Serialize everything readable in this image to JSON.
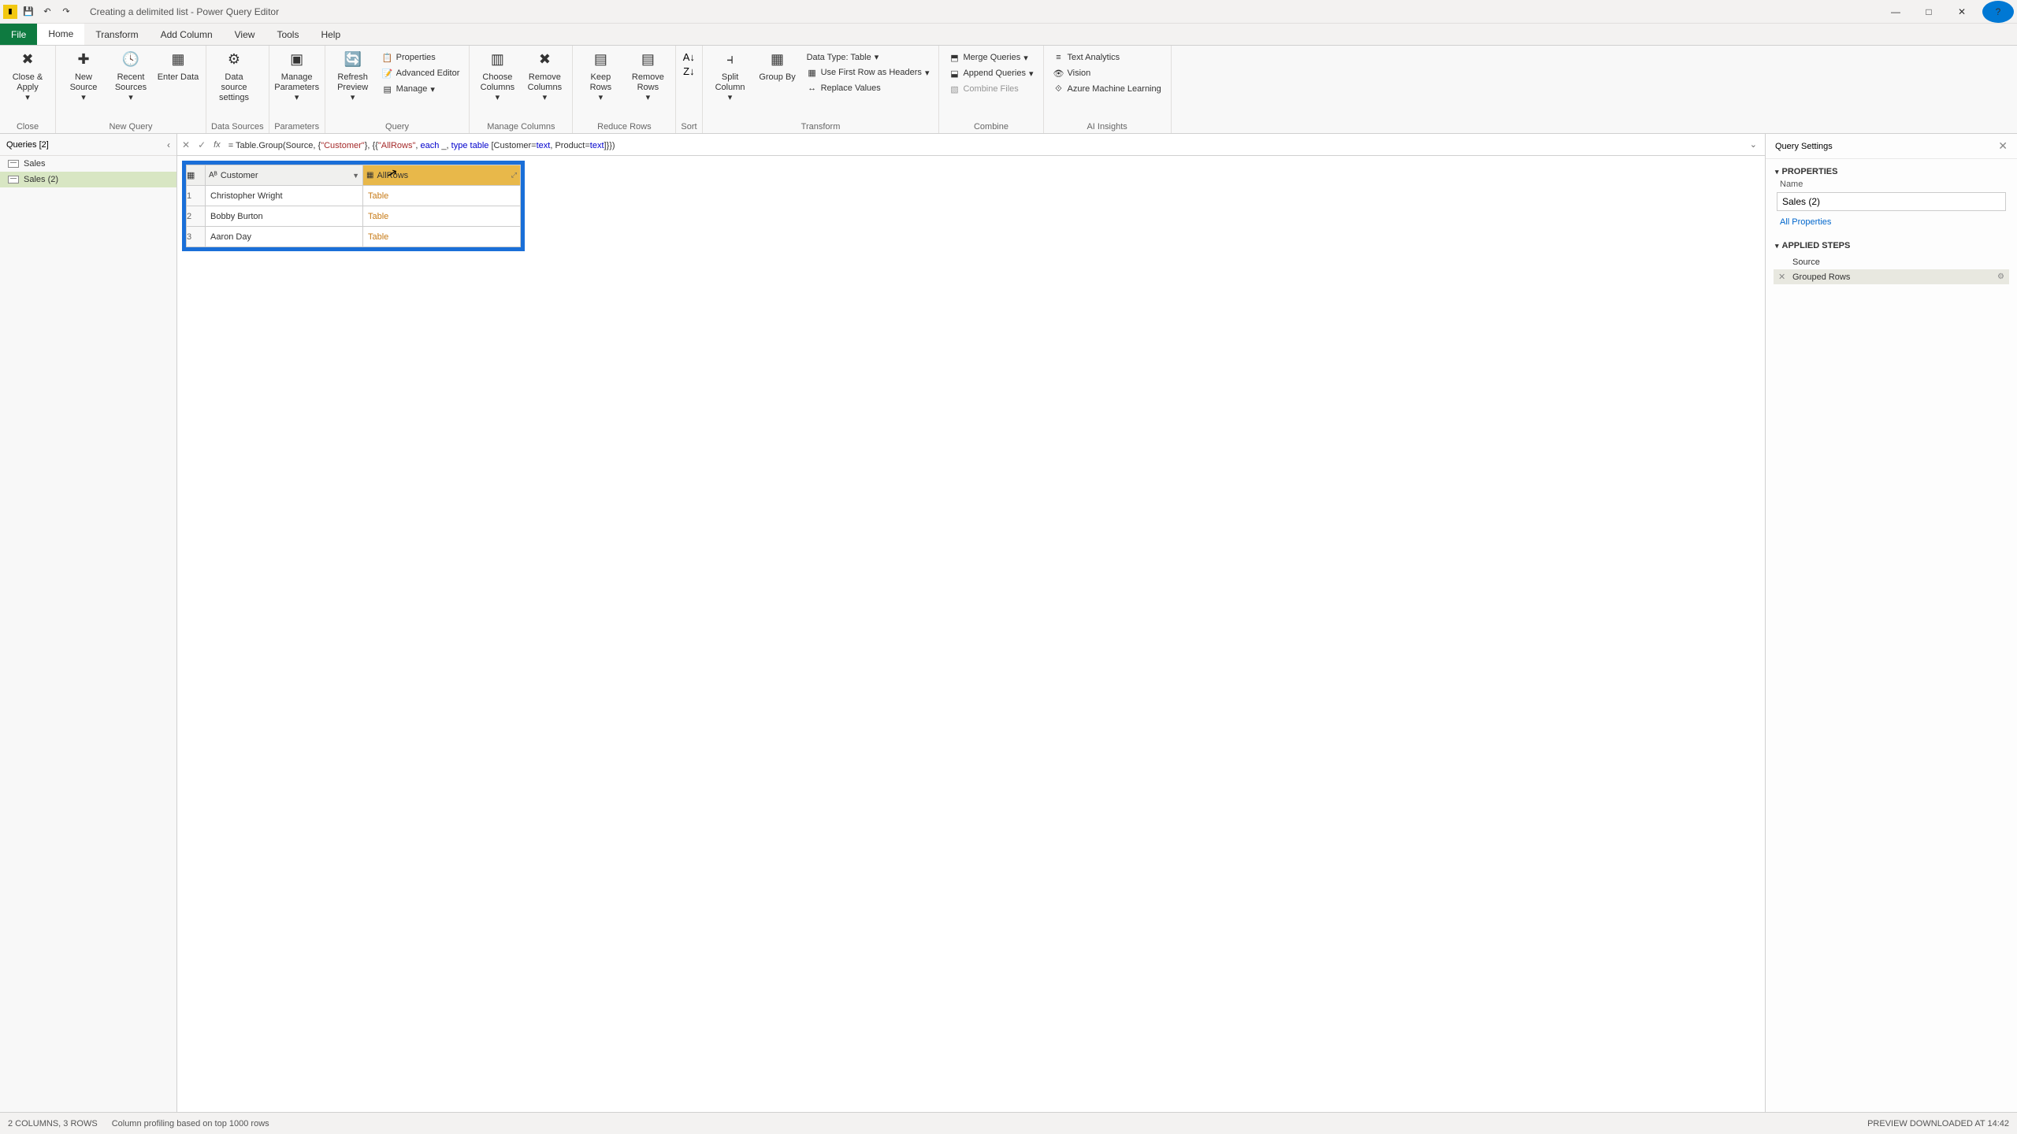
{
  "window": {
    "title": "Creating a delimited list - Power Query Editor"
  },
  "menu": {
    "file": "File",
    "tabs": [
      "Home",
      "Transform",
      "Add Column",
      "View",
      "Tools",
      "Help"
    ]
  },
  "ribbon": {
    "close_apply": "Close & Apply",
    "group_close": "Close",
    "new_source": "New Source",
    "recent_sources": "Recent Sources",
    "enter_data": "Enter Data",
    "group_newquery": "New Query",
    "data_source_settings": "Data source settings",
    "group_datasources": "Data Sources",
    "manage_parameters": "Manage Parameters",
    "group_parameters": "Parameters",
    "refresh_preview": "Refresh Preview",
    "properties": "Properties",
    "advanced_editor": "Advanced Editor",
    "manage": "Manage",
    "group_query": "Query",
    "choose_columns": "Choose Columns",
    "remove_columns": "Remove Columns",
    "group_managecols": "Manage Columns",
    "keep_rows": "Keep Rows",
    "remove_rows": "Remove Rows",
    "group_reducerows": "Reduce Rows",
    "group_sort": "Sort",
    "split_column": "Split Column",
    "group_by": "Group By",
    "data_type": "Data Type: Table",
    "first_row_headers": "Use First Row as Headers",
    "replace_values": "Replace Values",
    "group_transform": "Transform",
    "merge_queries": "Merge Queries",
    "append_queries": "Append Queries",
    "combine_files": "Combine Files",
    "group_combine": "Combine",
    "text_analytics": "Text Analytics",
    "vision": "Vision",
    "azure_ml": "Azure Machine Learning",
    "group_ai": "AI Insights"
  },
  "queries": {
    "header": "Queries [2]",
    "items": [
      "Sales",
      "Sales (2)"
    ]
  },
  "formula": {
    "prefix": "= Table.Group(Source, {",
    "str1": "\"Customer\"",
    "mid1": "}, {{",
    "str2": "\"AllRows\"",
    "mid2": ", ",
    "kw_each": "each",
    "mid3": " _, ",
    "kw_type": "type",
    "mid4": " ",
    "kw_table": "table",
    "mid5": " [Customer=",
    "kw_text1": "text",
    "mid6": ", Product=",
    "kw_text2": "text",
    "suffix": "]}})"
  },
  "preview": {
    "col1": "Customer",
    "col2": "AllRows",
    "rows": [
      {
        "n": "1",
        "customer": "Christopher Wright",
        "allrows": "Table"
      },
      {
        "n": "2",
        "customer": "Bobby Burton",
        "allrows": "Table"
      },
      {
        "n": "3",
        "customer": "Aaron Day",
        "allrows": "Table"
      }
    ]
  },
  "settings": {
    "title": "Query Settings",
    "properties": "PROPERTIES",
    "name_label": "Name",
    "name_value": "Sales (2)",
    "all_properties": "All Properties",
    "applied_steps": "APPLIED STEPS",
    "steps": [
      "Source",
      "Grouped Rows"
    ]
  },
  "status": {
    "left1": "2 COLUMNS, 3 ROWS",
    "left2": "Column profiling based on top 1000 rows",
    "right": "PREVIEW DOWNLOADED AT 14:42"
  }
}
